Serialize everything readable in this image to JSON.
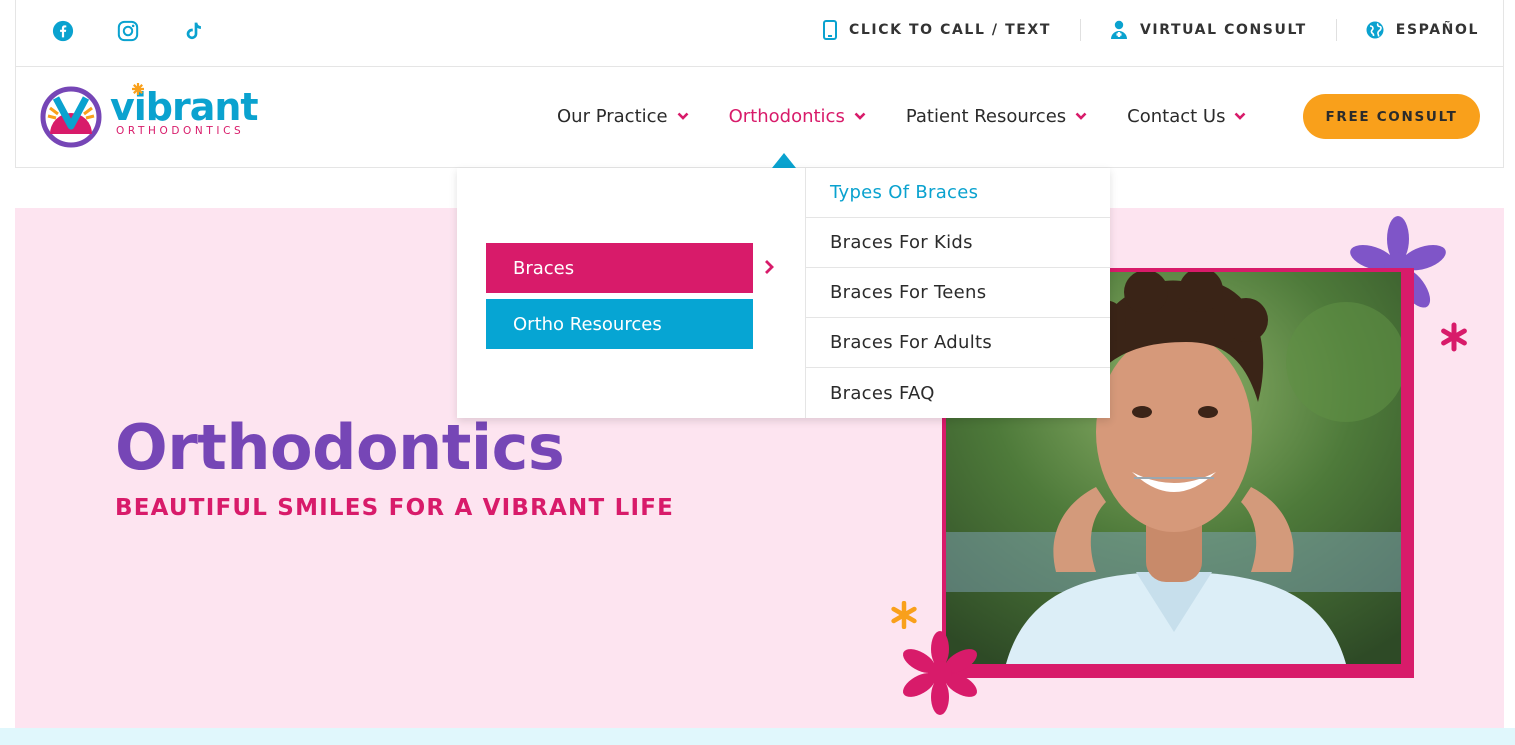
{
  "topbar": {
    "social": [
      {
        "name": "facebook-icon"
      },
      {
        "name": "instagram-icon"
      },
      {
        "name": "tiktok-icon"
      }
    ],
    "call_label": "CLICK TO CALL / TEXT",
    "consult_label": "VIRTUAL CONSULT",
    "language_label": "ESPAÑOL"
  },
  "header": {
    "logo_word": "vibrant",
    "logo_sub": "ORTHODONTICS",
    "nav": [
      "Our Practice",
      "Orthodontics",
      "Patient Resources",
      "Contact Us"
    ],
    "cta_label": "FREE CONSULT"
  },
  "dropdown": {
    "categories": [
      "Braces",
      "Ortho Resources"
    ],
    "links": [
      "Types Of Braces",
      "Braces For Kids",
      "Braces For Teens",
      "Braces For Adults",
      "Braces FAQ"
    ]
  },
  "hero": {
    "title": "Orthodontics",
    "subtitle": "BEAUTIFUL SMILES FOR A VIBRANT LIFE"
  },
  "colors": {
    "brand_blue": "#0aa2cf",
    "brand_pink": "#d81b6a",
    "brand_purple": "#7646b6",
    "brand_orange": "#f9a01b",
    "hero_bg": "#fde4f0"
  }
}
